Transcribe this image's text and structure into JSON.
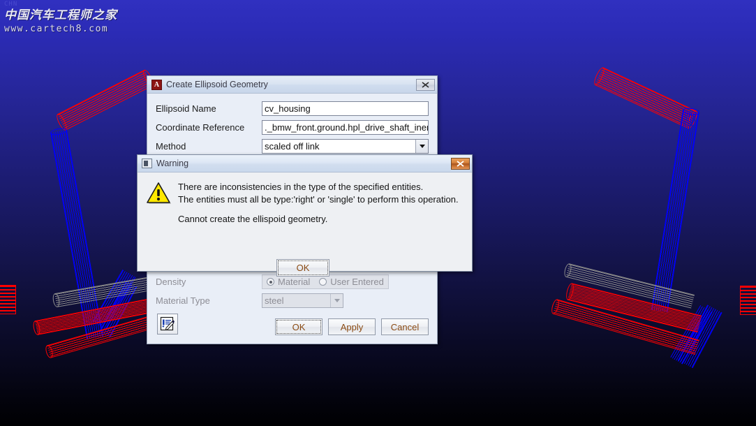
{
  "viewport": {
    "name": "adams-3d-viewport",
    "background_top_color": "#3030c0",
    "background_bottom_color": "#000002",
    "watermark": {
      "top_fragment": "CHN",
      "chinese": "中国汽车工程师之家",
      "url": "www.cartech8.com"
    },
    "geometry_colors": {
      "red": "#ff0000",
      "blue": "#0000ff",
      "grey": "#8a8a8a"
    }
  },
  "ellipsoid_dialog": {
    "title": "Create Ellipsoid Geometry",
    "app_icon_letter": "A",
    "close_icon": "close-icon",
    "fields": [
      {
        "label": "Ellipsoid Name",
        "value": "cv_housing",
        "type": "text"
      },
      {
        "label": "Coordinate Reference",
        "value": "._bmw_front.ground.hpl_drive_shaft_iner",
        "type": "text"
      },
      {
        "label": "Method",
        "value": "scaled off link",
        "type": "combo"
      }
    ],
    "density": {
      "label": "Density",
      "options": [
        {
          "label": "Material",
          "checked": true
        },
        {
          "label": "User Entered",
          "checked": false
        }
      ]
    },
    "material_type": {
      "label": "Material Type",
      "value": "steel"
    },
    "edit_icon": "pencil-edit-icon",
    "buttons": [
      {
        "label": "OK",
        "focused": true
      },
      {
        "label": "Apply",
        "focused": false
      },
      {
        "label": "Cancel",
        "focused": false
      }
    ]
  },
  "warning_dialog": {
    "title": "Warning",
    "window_icon": "window-icon",
    "close_icon": "close-icon",
    "alert_icon": "warning-triangle-icon",
    "message_line_1": "There are inconsistencies in the type of the specified entities.",
    "message_line_2": "The entities must all be type:'right' or 'single' to perform this operation.",
    "message_line_3": "Cannot create the ellispoid geometry.",
    "ok_label": "OK"
  }
}
